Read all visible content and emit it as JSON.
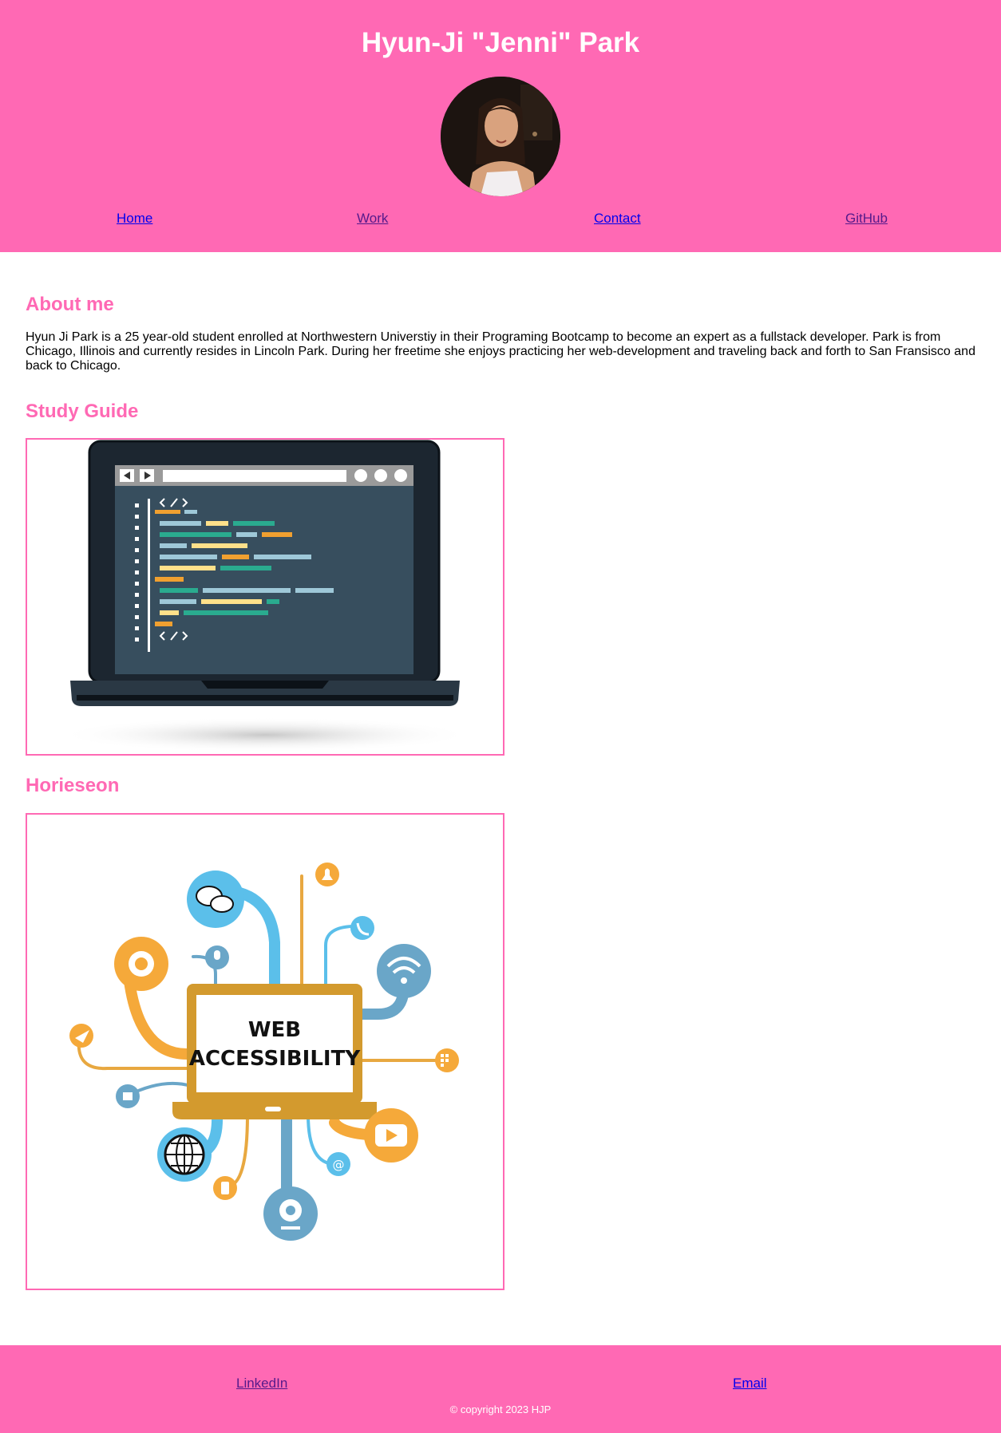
{
  "header": {
    "title": "Hyun-Ji \"Jenni\" Park",
    "nav": [
      "Home",
      "Work",
      "Contact",
      "GitHub"
    ]
  },
  "about": {
    "heading": "About me",
    "text": "Hyun Ji Park is a 25 year-old student enrolled at Northwestern Universtiy in their Programing Bootcamp to become an expert as a fullstack developer. Park is from Chicago, Illinois and currently resides in Lincoln Park. During her freetime she enjoys practicing her web-development and traveling back and forth to San Fransisco and back to Chicago."
  },
  "projects": [
    {
      "heading": "Study Guide"
    },
    {
      "heading": "Horieseon",
      "image_text": [
        "WEB",
        "ACCESSIBILITY"
      ]
    }
  ],
  "footer": {
    "links": [
      "LinkedIn",
      "Email"
    ],
    "copyright": "© copyright 2023 HJP"
  },
  "colors": {
    "brand": "#ff69b4",
    "link": "#0000ee",
    "visited": "#551a8b"
  }
}
